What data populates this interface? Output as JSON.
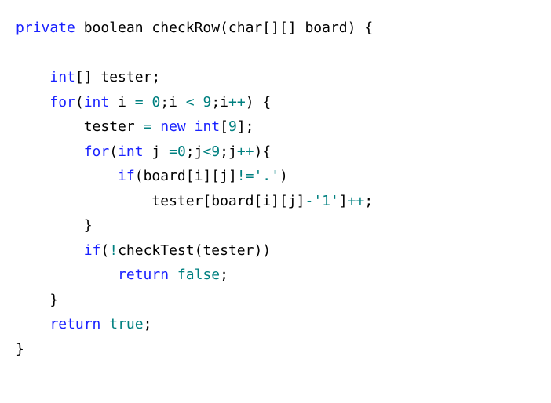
{
  "code": {
    "l1_kw_private": "private",
    "l1_rest": " boolean checkRow(char[][] board) {",
    "l2": "",
    "l3_indent": "    ",
    "l3_kw_int": "int",
    "l3_rest": "[] tester;",
    "l4_indent": "    ",
    "l4_kw_for": "for",
    "l4_p1": "(",
    "l4_kw_int": "int",
    "l4_p2": " i ",
    "l4_op_eq": "=",
    "l4_sp": " ",
    "l4_num_0": "0",
    "l4_p3": ";i ",
    "l4_op_lt": "<",
    "l4_sp2": " ",
    "l4_num_9": "9",
    "l4_p4": ";i",
    "l4_op_pp": "++",
    "l4_p5": ") {",
    "l5_indent": "        tester ",
    "l5_op_eq": "=",
    "l5_sp": " ",
    "l5_kw_new": "new",
    "l5_sp2": " ",
    "l5_kw_int": "int",
    "l5_p1": "[",
    "l5_num_9": "9",
    "l5_p2": "];",
    "l6_indent": "        ",
    "l6_kw_for": "for",
    "l6_p1": "(",
    "l6_kw_int": "int",
    "l6_p2": " j ",
    "l6_op_eq": "=",
    "l6_num_0": "0",
    "l6_p3": ";j",
    "l6_op_lt": "<",
    "l6_num_9": "9",
    "l6_p4": ";j",
    "l6_op_pp": "++",
    "l6_p5": "){",
    "l7_indent": "            ",
    "l7_kw_if": "if",
    "l7_p1": "(board[i][j]",
    "l7_op_ne": "!=",
    "l7_char": "'.'",
    "l7_p2": ")",
    "l8_indent": "                tester[board[i][j]",
    "l8_op_minus": "-",
    "l8_char": "'1'",
    "l8_p1": "]",
    "l8_op_pp": "++",
    "l8_p2": ";",
    "l9": "        }",
    "l10_indent": "        ",
    "l10_kw_if": "if",
    "l10_p1": "(",
    "l10_op_not": "!",
    "l10_p2": "checkTest(tester))",
    "l11_indent": "            ",
    "l11_kw_return": "return",
    "l11_sp": " ",
    "l11_bool": "false",
    "l11_p1": ";",
    "l12": "    }",
    "l13_indent": "    ",
    "l13_kw_return": "return",
    "l13_sp": " ",
    "l13_bool": "true",
    "l13_p1": ";",
    "l14": "}"
  }
}
